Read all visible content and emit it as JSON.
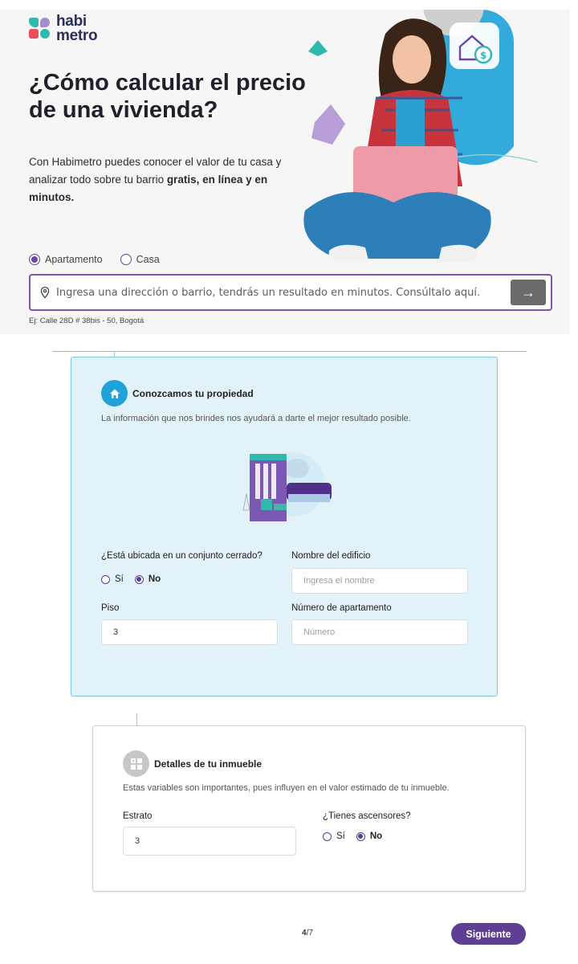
{
  "brand": {
    "line1": "habi",
    "line2": "metro"
  },
  "hero": {
    "title": "¿Cómo calcular el precio de una vivienda?",
    "desc_plain": "Con Habimetro puedes conocer el valor de tu casa y analizar todo sobre tu barrio ",
    "desc_bold1": "gratis",
    "desc_sep": ", ",
    "desc_bold2": "en línea y en minutos.",
    "property_types": [
      "Apartamento",
      "Casa"
    ],
    "selected_type": "Apartamento",
    "search_placeholder": "Ingresa una dirección o barrio, tendrás un resultado en minutos. Consúltalo aquí.",
    "example": "Ej: Calle 28D # 38bis - 50, Bogotá"
  },
  "property_section": {
    "title": "Conozcamos tu propiedad",
    "subtitle": "La información que nos brindes nos ayudará a darte el mejor resultado posible.",
    "gated_label": "¿Está ubicada en un conjunto cerrado?",
    "yes_label": "Sí",
    "no_label": "No",
    "gated_value": "No",
    "building_label": "Nombre del edificio",
    "building_placeholder": "Ingresa el nombre",
    "floor_label": "Piso",
    "floor_value": "3",
    "apt_label": "Número de apartamento",
    "apt_placeholder": "Número"
  },
  "details_section": {
    "title": "Detalles de tu inmueble",
    "subtitle": "Estas variables son importantes, pues influyen en el valor estimado de tu inmueble.",
    "stratum_label": "Estrato",
    "stratum_value": "3",
    "elevator_label": "¿Tienes ascensores?",
    "yes_label": "Sí",
    "no_label": "No",
    "elevator_value": "No"
  },
  "pager": {
    "current": "4",
    "total": "/7"
  },
  "next_label": "Siguiente",
  "colors": {
    "accent": "#6b46a3",
    "primary_blue": "#1ea2d9",
    "card_bg": "#e2f2f9"
  }
}
